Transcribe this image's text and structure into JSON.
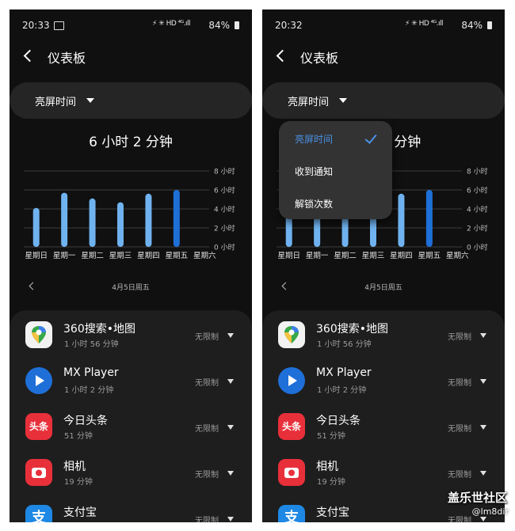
{
  "status_left": {
    "time": "20:33",
    "battery": "84%",
    "signal": "⚡ ✳ HD ⁴ᴳ.ıll"
  },
  "status_right": {
    "time": "20:32",
    "battery": "84%",
    "signal": "⚡ ✳ HD ⁴ᴳ.ıll"
  },
  "header": {
    "title": "仪表板"
  },
  "metric": {
    "label": "亮屏时间",
    "total": "6 小时 2 分钟",
    "total_partial": "2 分钟"
  },
  "dropdown": {
    "items": [
      "亮屏时间",
      "收到通知",
      "解锁次数"
    ],
    "selected": 0
  },
  "date": {
    "label": "4月5日周五"
  },
  "chart_data": {
    "type": "bar",
    "categories": [
      "星期日",
      "星期一",
      "星期二",
      "星期三",
      "星期四",
      "星期五",
      "星期六"
    ],
    "values": [
      4.1,
      5.7,
      5.1,
      4.7,
      5.6,
      6.0,
      0
    ],
    "highlight_index": 5,
    "y_ticks": [
      "0 小时",
      "2 小时",
      "4 小时",
      "6 小时",
      "8 小时"
    ],
    "ylim": [
      0,
      8
    ],
    "colors": {
      "bar": "#6fb2ef",
      "highlight": "#1f6fd8",
      "grid": "#3c3c3c"
    }
  },
  "apps": [
    {
      "name": "360搜索•地图",
      "duration": "1 小时 56 分钟",
      "limit": "无限制",
      "icon": "map-pin-icon"
    },
    {
      "name": "MX Player",
      "duration": "1 小时 2 分钟",
      "limit": "无限制",
      "icon": "play-icon"
    },
    {
      "name": "今日头条",
      "duration": "51 分钟",
      "limit": "无限制",
      "icon": "toutiao-icon",
      "icon_text": "头条"
    },
    {
      "name": "相机",
      "duration": "19 分钟",
      "limit": "无限制",
      "icon": "camera-icon"
    },
    {
      "name": "支付宝",
      "duration": "",
      "limit": "无限制",
      "icon": "alipay-icon",
      "icon_text": "支"
    }
  ],
  "watermark": {
    "text": "盖乐世社区",
    "user": "@lm8dir"
  }
}
